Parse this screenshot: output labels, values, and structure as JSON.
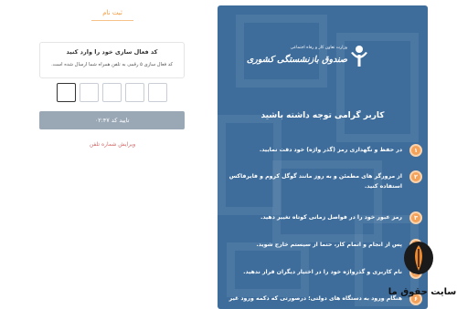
{
  "form": {
    "tab_title": "ثبت نام",
    "info_title": "کد فعال سازی خود را وارد کنید",
    "info_desc": "کد فعال سازی ۵ رقمی به تلفن همراه شما ارسال شده است.",
    "code_boxes": 5,
    "confirm_label": "تایید کد ۰۲:۴۷",
    "edit_phone_label": "ویرایش شماره تلفن"
  },
  "panel": {
    "logo_top_text": "وزارت تعاون کار و رفاه اجتماعی",
    "logo_main_text": "صندوق بازنشستگی کشوری",
    "heading": "کاربر گرامی توجه داشته باشید",
    "tips": [
      {
        "num": "۱",
        "text": "در حفظ و نگهداری رمز (گذر واژه) خود دقت نمایید."
      },
      {
        "num": "۲",
        "text": "از مرورگر های مطمئن و به روز مانند گوگل کروم و فایرفاکس استفاده کنید."
      },
      {
        "num": "۳",
        "text": "رمز عبور خود را در فواصل زمانی کوتاه تغییر دهید."
      },
      {
        "num": "۴",
        "text": "پس از انجام و اتمام کار، حتما از سیستم خارج شوید."
      },
      {
        "num": "۵",
        "text": "نام کاربری و گذرواژه خود را در اختیار دیگران قرار ندهید."
      },
      {
        "num": "۶",
        "text": "هنگام ورود به دستگاه های دولتی؛ درصورتی که دکمه ورود غیر"
      }
    ]
  },
  "watermark": {
    "text": "سایت حقوق ما"
  },
  "colors": {
    "panel_bg": "#3e6d9c",
    "accent_orange": "#f4a259",
    "button_gray": "#9aa8b6",
    "link_red": "#d46a6a"
  }
}
